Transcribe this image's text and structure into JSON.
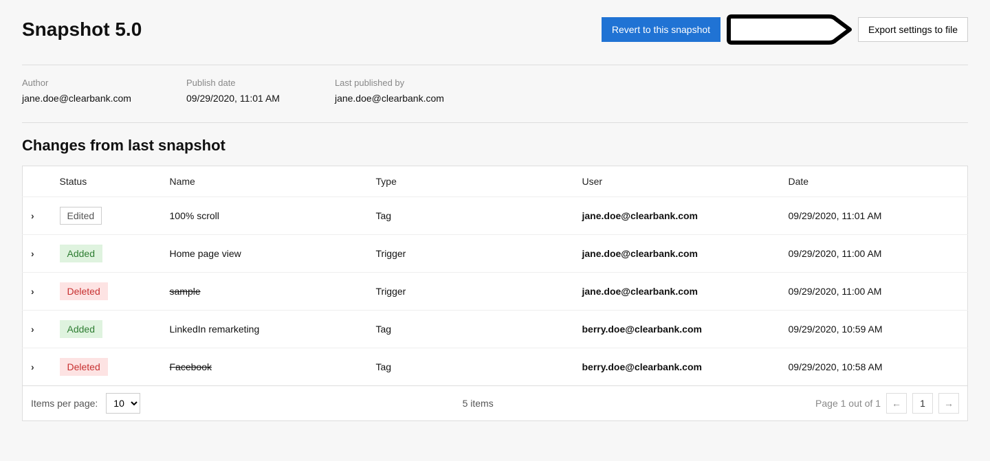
{
  "header": {
    "title": "Snapshot 5.0",
    "revert_label": "Revert to this snapshot",
    "export_label": "Export settings to file"
  },
  "meta": {
    "author_label": "Author",
    "author_value": "jane.doe@clearbank.com",
    "publish_date_label": "Publish date",
    "publish_date_value": "09/29/2020, 11:01 AM",
    "last_published_by_label": "Last published by",
    "last_published_by_value": "jane.doe@clearbank.com"
  },
  "section": {
    "title": "Changes from last snapshot"
  },
  "columns": {
    "status": "Status",
    "name": "Name",
    "type": "Type",
    "user": "User",
    "date": "Date"
  },
  "status_labels": {
    "edited": "Edited",
    "added": "Added",
    "deleted": "Deleted"
  },
  "rows": [
    {
      "status": "edited",
      "name": "100% scroll",
      "type": "Tag",
      "user": "jane.doe@clearbank.com",
      "date": "09/29/2020, 11:01 AM"
    },
    {
      "status": "added",
      "name": "Home page view",
      "type": "Trigger",
      "user": "jane.doe@clearbank.com",
      "date": "09/29/2020, 11:00 AM"
    },
    {
      "status": "deleted",
      "name": "sample",
      "type": "Trigger",
      "user": "jane.doe@clearbank.com",
      "date": "09/29/2020, 11:00 AM"
    },
    {
      "status": "added",
      "name": "LinkedIn remarketing",
      "type": "Tag",
      "user": "berry.doe@clearbank.com",
      "date": "09/29/2020, 10:59 AM"
    },
    {
      "status": "deleted",
      "name": "Facebook",
      "type": "Tag",
      "user": "berry.doe@clearbank.com",
      "date": "09/29/2020, 10:58 AM"
    }
  ],
  "footer": {
    "items_per_page_label": "Items per page:",
    "items_per_page_value": "10",
    "total_items": "5 items",
    "page_label": "Page 1 out of 1",
    "current_page": "1"
  }
}
